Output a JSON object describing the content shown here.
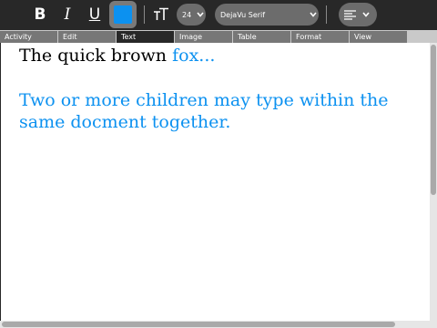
{
  "toolbar": {
    "bold_label": "B",
    "italic_label": "I",
    "underline_label": "U",
    "text_color": "#0c91f0",
    "text_size_icon": "text-size-icon",
    "font_size": "24",
    "font_family": "DejaVu Serif",
    "alignment_icon": "align-left-icon"
  },
  "tabs": [
    {
      "label": "Activity",
      "active": false
    },
    {
      "label": "Edit",
      "active": false
    },
    {
      "label": "Text",
      "active": true
    },
    {
      "label": "Image",
      "active": false
    },
    {
      "label": "Table",
      "active": false
    },
    {
      "label": "Format",
      "active": false
    },
    {
      "label": "View",
      "active": false
    }
  ],
  "document": {
    "line1_black": "The quick brown ",
    "line1_blue": "fox...",
    "paragraph2": "Two or more children may type within the same docment together.",
    "black_color": "#000000",
    "blue_color": "#0c91f0"
  }
}
